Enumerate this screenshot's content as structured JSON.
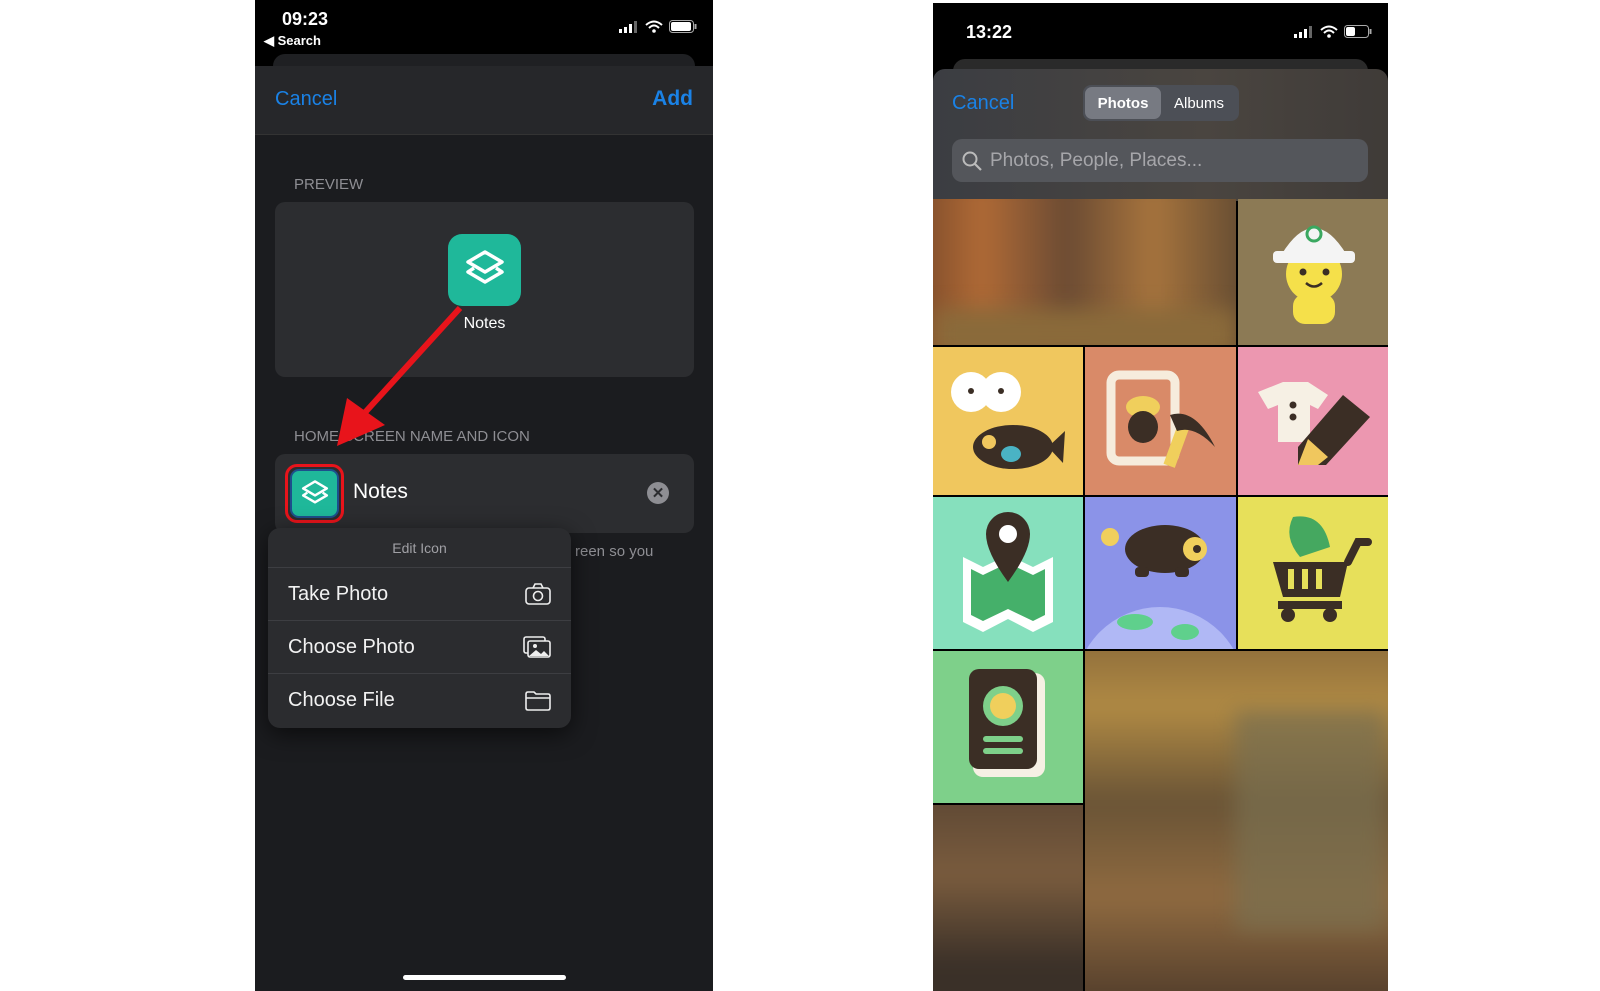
{
  "left_phone": {
    "status": {
      "time": "09:23",
      "back_label": "Search"
    },
    "header": {
      "cancel": "Cancel",
      "add": "Add"
    },
    "preview": {
      "section_label": "PREVIEW",
      "app_name": "Notes"
    },
    "home_screen": {
      "section_label": "HOME SCREEN NAME AND ICON",
      "name_value": "Notes",
      "hint_text": "reen so you"
    },
    "edit_icon_menu": {
      "title": "Edit Icon",
      "items": [
        {
          "label": "Take Photo",
          "icon": "camera-icon"
        },
        {
          "label": "Choose Photo",
          "icon": "photos-icon"
        },
        {
          "label": "Choose File",
          "icon": "folder-icon"
        }
      ]
    },
    "colors": {
      "accent": "#1a82e6",
      "app_icon": "#1fb89a",
      "highlight": "#e8141b"
    }
  },
  "right_phone": {
    "status": {
      "time": "13:22"
    },
    "header": {
      "cancel": "Cancel",
      "tabs": [
        {
          "label": "Photos",
          "selected": true
        },
        {
          "label": "Albums",
          "selected": false
        }
      ]
    },
    "search": {
      "placeholder": "Photos, People, Places..."
    },
    "tiles": [
      {
        "icon": "blurred-photo"
      },
      {
        "icon": "construction-worker-icon",
        "color": "#8c7a55"
      },
      {
        "icon": "bug-fish-icon",
        "color": "#f0c75e"
      },
      {
        "icon": "acorn-diy-icon",
        "color": "#d98a68"
      },
      {
        "icon": "shirt-pencil-icon",
        "color": "#ec97b0"
      },
      {
        "icon": "map-pin-icon",
        "color": "#86e0bd"
      },
      {
        "icon": "bear-globe-icon",
        "color": "#8b93e8"
      },
      {
        "icon": "shopping-cart-leaf-icon",
        "color": "#e7e05a"
      },
      {
        "icon": "passport-icon",
        "color": "#7ed08a"
      }
    ]
  }
}
